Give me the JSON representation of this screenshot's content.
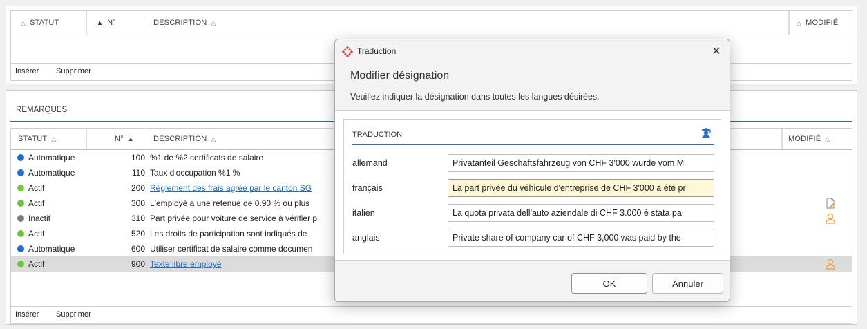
{
  "top_table": {
    "columns": {
      "statut": "STATUT",
      "num": "N°",
      "description": "DESCRIPTION",
      "modifie": "MODIFIÉ"
    },
    "footer": {
      "insert": "Insérer",
      "delete": "Supprimer"
    }
  },
  "remarks": {
    "title": "REMARQUES",
    "columns": {
      "statut": "STATUT",
      "num": "N°",
      "description": "DESCRIPTION",
      "modifie": "MODIFIÉ"
    },
    "rows": [
      {
        "status": "Automatique",
        "status_color": "#1f6fcf",
        "num": "100",
        "description": "%1 de %2 certificats de salaire",
        "link": false,
        "modified_icon": ""
      },
      {
        "status": "Automatique",
        "status_color": "#1f6fcf",
        "num": "110",
        "description": "Taux d'occupation %1 %",
        "link": false,
        "modified_icon": ""
      },
      {
        "status": "Actif",
        "status_color": "#6cc644",
        "num": "200",
        "description": "Règlement des frais agréé par le canton SG",
        "link": true,
        "modified_icon": ""
      },
      {
        "status": "Actif",
        "status_color": "#6cc644",
        "num": "300",
        "description": "L'employé a une retenue de 0.90 % ou plus",
        "link": false,
        "modified_icon": "edit-document-icon"
      },
      {
        "status": "Inactif",
        "status_color": "#7a7f87",
        "num": "310",
        "description": "Part privée pour voiture de service à vérifier p",
        "link": false,
        "modified_icon": "user-icon"
      },
      {
        "status": "Actif",
        "status_color": "#6cc644",
        "num": "520",
        "description": "Les droits de participation sont indiqués de",
        "link": false,
        "modified_icon": ""
      },
      {
        "status": "Automatique",
        "status_color": "#1f6fcf",
        "num": "600",
        "description": "Utiliser certificat de salaire comme documen",
        "link": false,
        "modified_icon": ""
      },
      {
        "status": "Actif",
        "status_color": "#6cc644",
        "num": "900",
        "description": "Texte libre employé",
        "link": true,
        "modified_icon": "user-icon",
        "selected": true
      }
    ],
    "footer": {
      "insert": "Insérer",
      "delete": "Supprimer"
    }
  },
  "dialog": {
    "title": "Traduction",
    "heading": "Modifier désignation",
    "subtitle": "Veuillez indiquer la désignation dans toutes les langues désirées.",
    "section_title": "TRADUCTION",
    "languages": [
      {
        "label": "allemand",
        "value": "Privatanteil Geschäftsfahrzeug von CHF 3'000 wurde vom M"
      },
      {
        "label": "français",
        "value": "La part privée du véhicule d'entreprise de CHF 3'000 a été pr",
        "focused": true
      },
      {
        "label": "italien",
        "value": "La quota privata dell'auto aziendale di CHF 3.000 è stata pa"
      },
      {
        "label": "anglais",
        "value": "Private share of company car of CHF 3,000 was paid by the"
      }
    ],
    "ok_label": "OK",
    "cancel_label": "Annuler"
  },
  "colors": {
    "accent_line": "#2b6cb0",
    "link": "#1a6fc4",
    "modified_icon": "#f0a030",
    "focus_field": "#fff8d8"
  }
}
